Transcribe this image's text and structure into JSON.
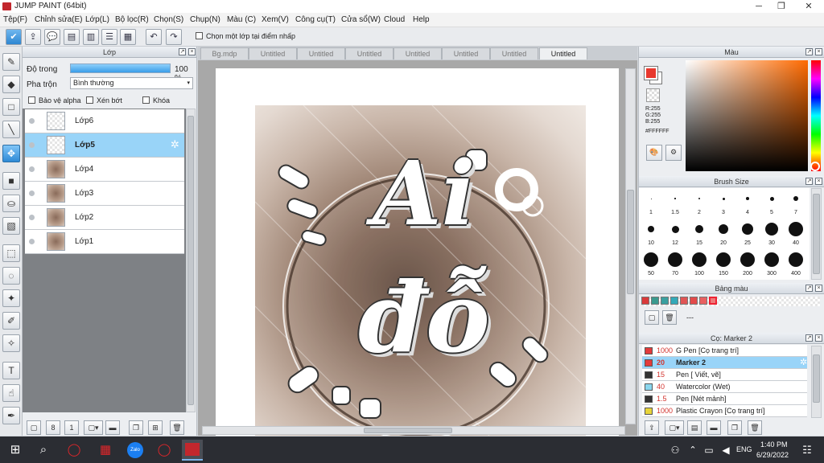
{
  "window": {
    "title": "JUMP PAINT (64bit)"
  },
  "menu": [
    "Tệp(F)",
    "Chỉnh sửa(E)",
    "Lớp(L)",
    "Bộ lọc(R)",
    "Chọn(S)",
    "Chụp(N)",
    "Màu (C)",
    "Xem(V)",
    "Công cụ(T)",
    "Cửa sổ(W)",
    "Cloud",
    "Help"
  ],
  "toolbar": {
    "pick_layer_label": "Chọn một lớp tại điểm nhấp"
  },
  "layer_panel": {
    "title": "Lớp",
    "opacity_label": "Độ trong",
    "opacity_value": "100 %",
    "opacity_fraction": 1.0,
    "blend_label": "Pha trộn",
    "blend_value": "Bình thường",
    "protect_alpha": "Bảo vệ alpha",
    "clip": "Xén bớt",
    "lock": "Khóa",
    "layers": [
      {
        "name": "Lớp6",
        "selected": false,
        "thumb": "empty"
      },
      {
        "name": "Lớp5",
        "selected": true,
        "thumb": "empty"
      },
      {
        "name": "Lớp4",
        "selected": false,
        "thumb": "image"
      },
      {
        "name": "Lớp3",
        "selected": false,
        "thumb": "image"
      },
      {
        "name": "Lớp2",
        "selected": false,
        "thumb": "image"
      },
      {
        "name": "Lớp1",
        "selected": false,
        "thumb": "image"
      }
    ]
  },
  "tabs": [
    "Bg.mdp",
    "Untitled",
    "Untitled",
    "Untitled",
    "Untitled",
    "Untitled",
    "Untitled",
    "Untitled"
  ],
  "active_tab": 7,
  "artwork": {
    "line1": "Ai",
    "line2": "đỗ"
  },
  "color_panel": {
    "title": "Màu",
    "r": "R:255",
    "g": "G:255",
    "b": "B:255",
    "hex": "#FFFFFF",
    "fg": "#e8382e",
    "bg": "#ffffff"
  },
  "brush_size": {
    "title": "Brush Size",
    "sizes": [
      "1",
      "1.5",
      "2",
      "3",
      "4",
      "5",
      "7",
      "10",
      "12",
      "15",
      "20",
      "25",
      "30",
      "40",
      "50",
      "70",
      "100",
      "150",
      "200",
      "300",
      "400"
    ]
  },
  "palette": {
    "title": "Bảng màu",
    "more": "---",
    "colors": [
      "#d93a3a",
      "#3a9a8f",
      "#3aa0a0",
      "#33a9b8",
      "#e05555",
      "#e24a4a",
      "#e86060",
      "#ee7a7a"
    ]
  },
  "brush_panel": {
    "title": "Cọ: Marker 2",
    "brushes": [
      {
        "size": "1000",
        "name": "G Pen [Cọ trang trí]",
        "color": "#e33b3b",
        "selected": false
      },
      {
        "size": "20",
        "name": "Marker 2",
        "color": "#e33b3b",
        "selected": true
      },
      {
        "size": "15",
        "name": "Pen [ Viết, vẽ]",
        "color": "#333333",
        "selected": false
      },
      {
        "size": "40",
        "name": "Watercolor (Wet)",
        "color": "#8ad6ee",
        "selected": false
      },
      {
        "size": "1.5",
        "name": "Pen [Nét mảnh]",
        "color": "#333333",
        "selected": false
      },
      {
        "size": "1000",
        "name": "Plastic Crayon [Cọ trang trí]",
        "color": "#e8d43a",
        "selected": false
      }
    ]
  },
  "taskbar": {
    "lang": "ENG",
    "time": "1:40 PM",
    "date": "6/29/2022",
    "zalo": "Zalo"
  }
}
